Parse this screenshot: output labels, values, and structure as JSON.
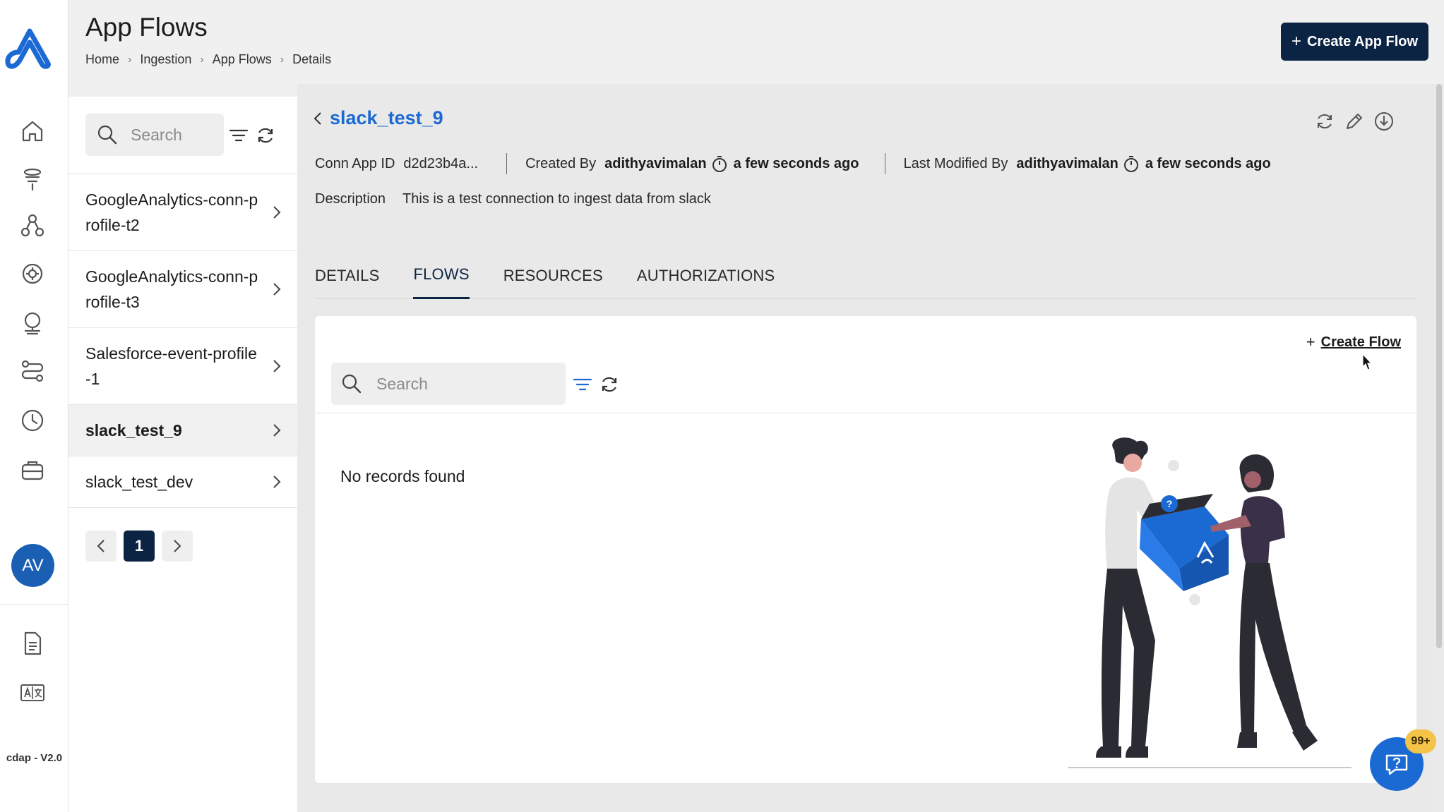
{
  "app": {
    "version": "cdap - V2.0",
    "avatar_initials": "AV",
    "accent_color": "#1b6ad4",
    "primary_dark": "#0c2444"
  },
  "rail": {
    "icons": [
      "home-icon",
      "funnel-icon",
      "network-icon",
      "settings-gear-icon",
      "globe-stand-icon",
      "flows-icon",
      "clock-icon",
      "briefcase-icon"
    ],
    "bottom_icons": [
      "document-icon",
      "translate-icon"
    ]
  },
  "header": {
    "title": "App Flows",
    "breadcrumb": [
      "Home",
      "Ingestion",
      "App Flows",
      "Details"
    ],
    "create_button": "Create App Flow"
  },
  "list": {
    "search_placeholder": "Search",
    "items": [
      {
        "label": "GoogleAnalytics-conn-profile-t2",
        "active": false
      },
      {
        "label": "GoogleAnalytics-conn-profile-t3",
        "active": false
      },
      {
        "label": "Salesforce-event-profile-1",
        "active": false
      },
      {
        "label": "slack_test_9",
        "active": true
      },
      {
        "label": "slack_test_dev",
        "active": false
      }
    ],
    "pagination": {
      "current": "1"
    }
  },
  "detail": {
    "title": "slack_test_9",
    "conn_app_id_label": "Conn App ID",
    "conn_app_id_value": "d2d23b4a...",
    "created_by_label": "Created By",
    "created_by_user": "adithyavimalan",
    "created_time": "a few seconds ago",
    "modified_by_label": "Last Modified By",
    "modified_by_user": "adithyavimalan",
    "modified_time": "a few seconds ago",
    "description_label": "Description",
    "description_value": "This is a test connection to ingest data from slack",
    "tabs": [
      {
        "label": "DETAILS",
        "active": false
      },
      {
        "label": "FLOWS",
        "active": true
      },
      {
        "label": "RESOURCES",
        "active": false
      },
      {
        "label": "AUTHORIZATIONS",
        "active": false
      }
    ],
    "flows": {
      "create_label": "Create Flow",
      "search_placeholder": "Search",
      "empty_message": "No records found"
    }
  },
  "help": {
    "badge": "99+"
  }
}
